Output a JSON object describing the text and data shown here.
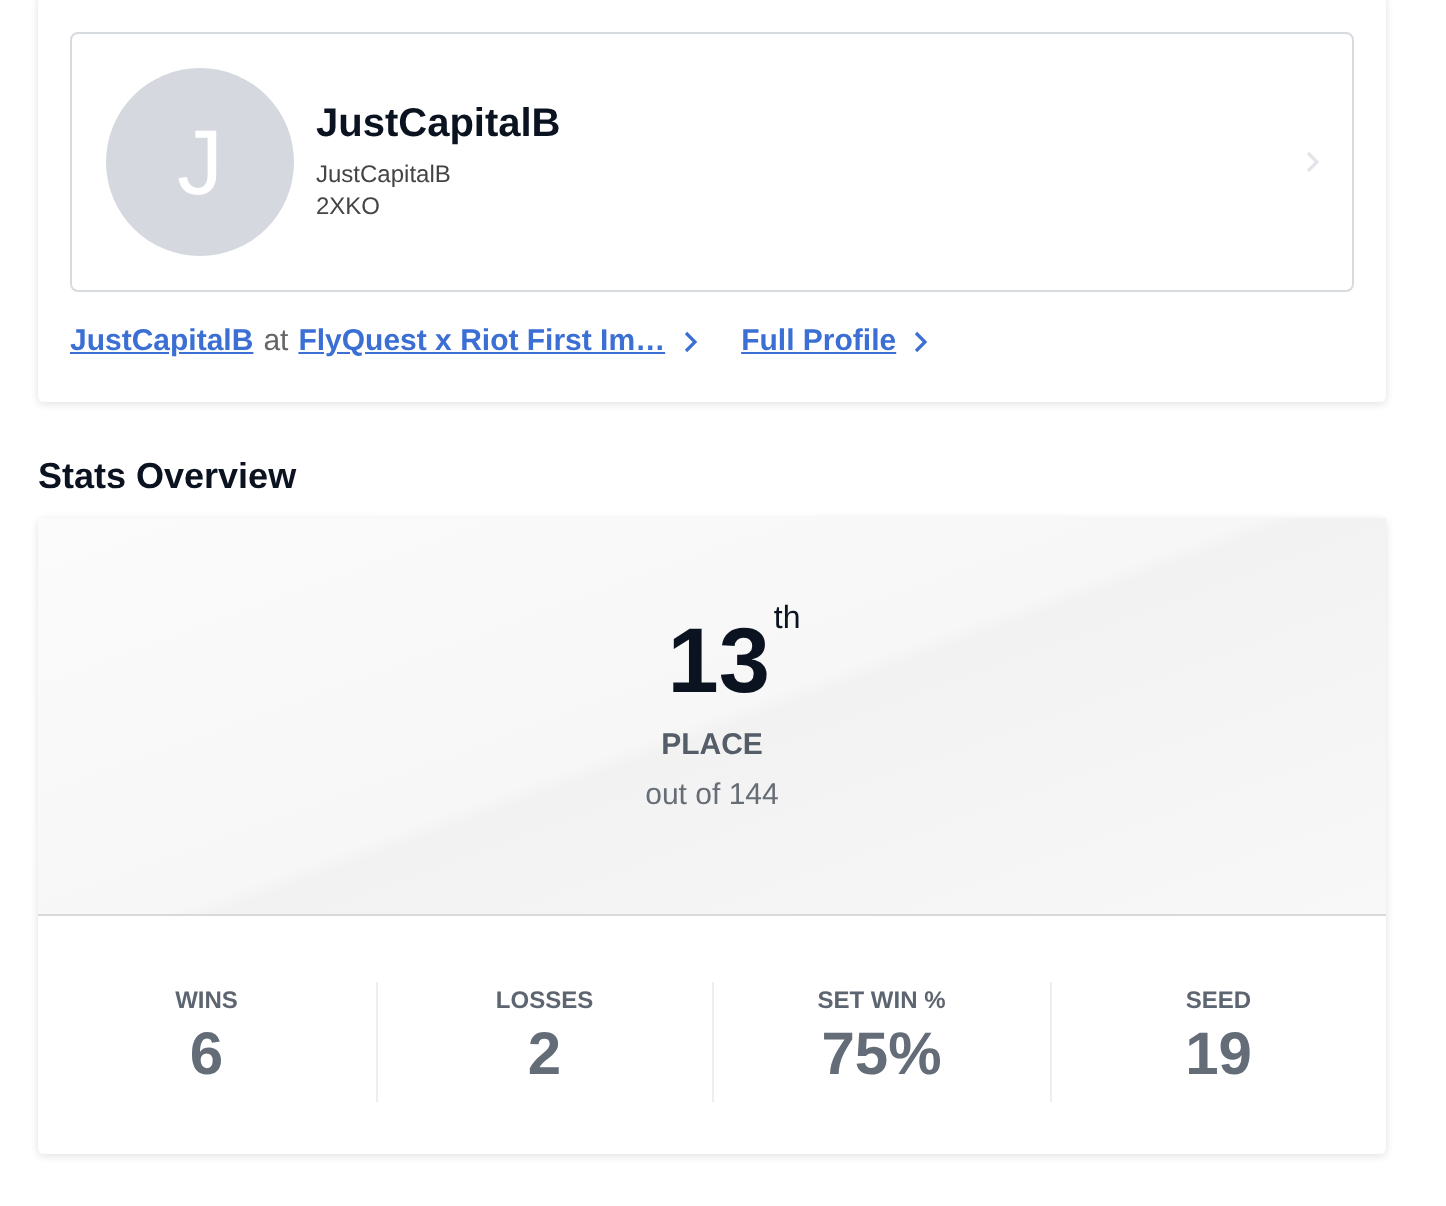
{
  "profile": {
    "avatar_letter": "J",
    "name": "JustCapitalB",
    "handle": "JustCapitalB",
    "game": "2XKO"
  },
  "links": {
    "player": "JustCapitalB",
    "joiner": "at",
    "event": "FlyQuest x Riot First Im…",
    "full_profile": "Full Profile"
  },
  "stats_overview": {
    "heading": "Stats Overview",
    "placement": "13$^{th}$",
    "placement_label": "PLACE",
    "out_of": "out of 144",
    "stats": [
      {
        "label": "WINS",
        "value": "6"
      },
      {
        "label": "LOSSES",
        "value": "2"
      },
      {
        "label": "SET WIN %",
        "value": "75%"
      },
      {
        "label": "SEED",
        "value": "19"
      }
    ]
  }
}
